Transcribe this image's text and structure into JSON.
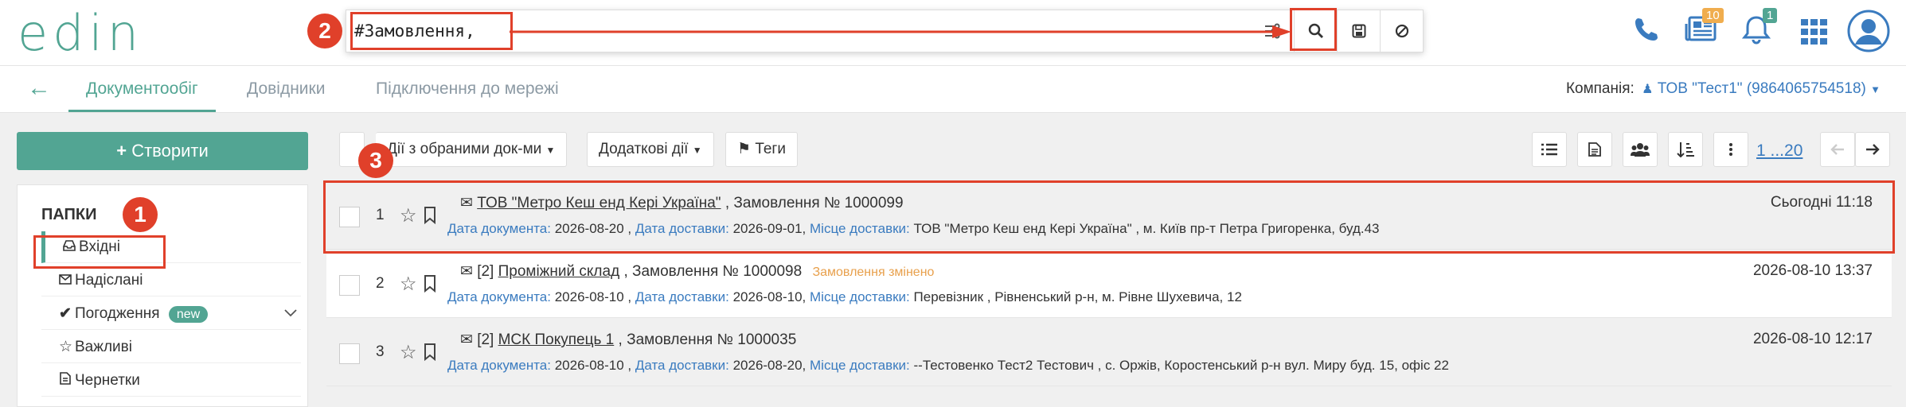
{
  "logo": {
    "text": "edin"
  },
  "search": {
    "value": "#Замовлення,"
  },
  "annotations": [
    "1",
    "2",
    "3"
  ],
  "header_icons": {
    "phone": "phone-icon",
    "news": {
      "icon": "newspaper-icon",
      "count": "10"
    },
    "bell": {
      "icon": "bell-icon",
      "count": "1"
    },
    "apps": "apps-grid-icon",
    "user": "user-avatar-icon"
  },
  "nav": {
    "back": "←",
    "tabs": [
      "Документообіг",
      "Довідники",
      "Підключення до мережі"
    ],
    "company_label": "Компанія:",
    "company_value": "ТОВ \"Тест1\" (9864065754518)"
  },
  "sidebar": {
    "create_label": "Створити",
    "folders_title": "ПАПКИ",
    "items": [
      {
        "label": "Вхідні",
        "icon": "inbox-icon"
      },
      {
        "label": "Надіслані",
        "icon": "envelope-icon"
      },
      {
        "label": "Погодження",
        "icon": "check-icon",
        "badge": "new"
      },
      {
        "label": "Важливі",
        "icon": "star-icon"
      },
      {
        "label": "Чернетки",
        "icon": "document-icon"
      }
    ]
  },
  "toolbar": {
    "bulk_actions": "Дії з обраними док-ми",
    "extra_actions": "Додаткові дії",
    "tags": "Теги",
    "pager": "1 ...20"
  },
  "rows": [
    {
      "num": "1",
      "prefix": "",
      "party": "ТОВ \"Метро Кеш енд Кері Україна\"",
      "doc": ", Замовлення № 1000099",
      "status": "",
      "doc_date_label": "Дата документа:",
      "doc_date": "2026-08-20 ,",
      "delivery_date_label": "Дата доставки:",
      "delivery_date": "2026-09-01,",
      "place_label": "Місце доставки:",
      "place": "ТОВ \"Метро Кеш енд Кері Україна\" , м. Київ пр-т Петра Григоренка, буд.43",
      "date": "Сьогодні 11:18"
    },
    {
      "num": "2",
      "prefix": "[2]",
      "party": "Проміжний склад",
      "doc": ", Замовлення № 1000098",
      "status": "Замовлення змінено",
      "doc_date_label": "Дата документа:",
      "doc_date": "2026-08-10 ,",
      "delivery_date_label": "Дата доставки:",
      "delivery_date": "2026-08-10,",
      "place_label": "Місце доставки:",
      "place": "Перевізник , Рівненський р-н, м. Рівне Шухевича, 12",
      "date": "2026-08-10 13:37"
    },
    {
      "num": "3",
      "prefix": "[2]",
      "party": "МСК Покупець 1",
      "doc": ", Замовлення № 1000035",
      "status": "",
      "doc_date_label": "Дата документа:",
      "doc_date": "2026-08-10 ,",
      "delivery_date_label": "Дата доставки:",
      "delivery_date": "2026-08-20,",
      "place_label": "Місце доставки:",
      "place": "--Тестовенко Тест2 Тестович , с. Оржів, Коростенський р-н вул. Миру буд. 15, офіс 22",
      "date": "2026-08-10 12:17"
    }
  ],
  "colors": {
    "accent": "#52a593",
    "link": "#3a7bbf",
    "highlight": "#e0402a",
    "badge_orange": "#f0ad4e",
    "badge_green": "#52a593"
  }
}
